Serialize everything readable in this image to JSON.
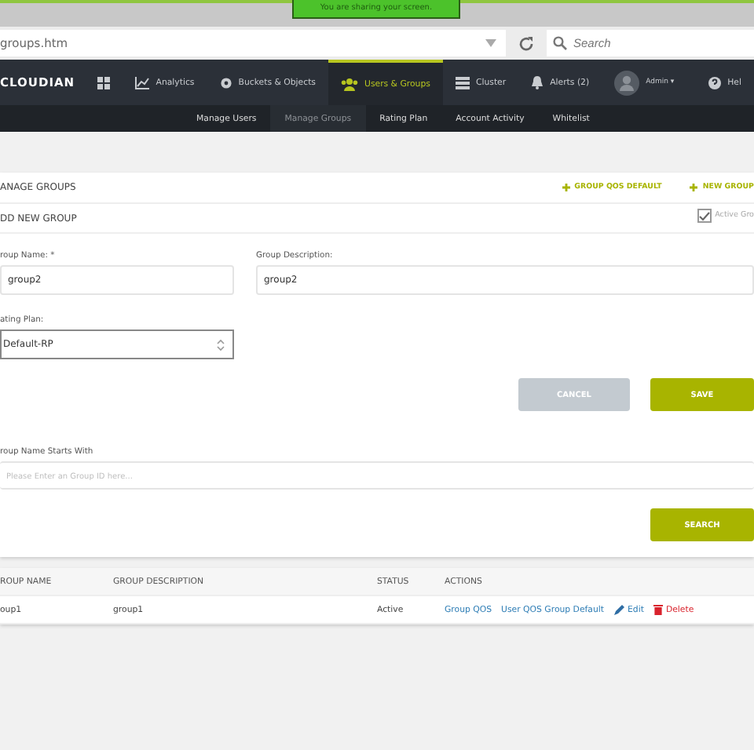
{
  "share_banner": "You are sharing your screen.",
  "browser": {
    "url": "groups.htm",
    "search_placeholder": "Search"
  },
  "nav": {
    "logo": "CLOUDIAN",
    "items": [
      {
        "kind": "grid",
        "selected": false
      },
      {
        "kind": "chart",
        "label": "Analytics",
        "selected": false
      },
      {
        "kind": "gear",
        "label": "Buckets & Objects",
        "selected": false
      },
      {
        "kind": "users",
        "label": "Users & Groups",
        "selected": true
      },
      {
        "kind": "list",
        "label": "Cluster",
        "selected": false
      },
      {
        "kind": "bell",
        "label": "Alerts (2)",
        "selected": false
      },
      {
        "kind": "avatar",
        "label": "Admin ▾",
        "selected": false
      },
      {
        "kind": "help",
        "label": "Hel",
        "selected": false
      }
    ]
  },
  "subnav": [
    {
      "label": "Manage Users",
      "selected": false
    },
    {
      "label": "Manage Groups",
      "selected": true
    },
    {
      "label": "Rating Plan",
      "selected": false
    },
    {
      "label": "Account Activity",
      "selected": false
    },
    {
      "label": "Whitelist",
      "selected": false
    }
  ],
  "panel": {
    "title": "ANAGE GROUPS",
    "links": [
      "GROUP QOS DEFAULT",
      "NEW GROUP"
    ],
    "subtitle": "DD NEW GROUP",
    "active": {
      "label": "Active Gro",
      "checked": true
    },
    "group_name": {
      "label": "roup Name: *",
      "value": "group2"
    },
    "group_description": {
      "label": "Group Description:",
      "value": "group2"
    },
    "rating_plan": {
      "label": "ating Plan:",
      "value": "Default-RP"
    },
    "buttons": [
      "CANCEL",
      "SAVE"
    ],
    "filter": {
      "label": "roup Name Starts With",
      "placeholder": "Please Enter an Group ID here..."
    },
    "search_button": "SEARCH"
  },
  "table": {
    "columns": [
      "ROUP NAME",
      "GROUP DESCRIPTION",
      "STATUS",
      "ACTIONS"
    ],
    "rows": [
      {
        "name": "oup1",
        "description": "group1",
        "status": "Active",
        "actions": [
          {
            "kind": "link",
            "label": "Group QOS"
          },
          {
            "kind": "link",
            "label": "User QOS Group Default"
          },
          {
            "kind": "edit",
            "label": "Edit"
          },
          {
            "kind": "delete",
            "label": "Delete"
          }
        ]
      }
    ]
  }
}
